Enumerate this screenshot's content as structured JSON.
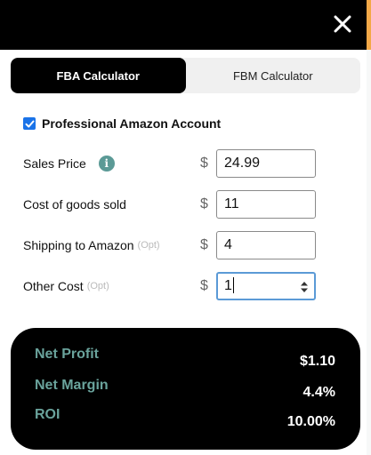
{
  "background": {
    "link_fragment": "e"
  },
  "tabs": [
    {
      "label": "FBA Calculator",
      "active": true
    },
    {
      "label": "FBM Calculator",
      "active": false
    }
  ],
  "professional_account": {
    "label": "Professional Amazon Account",
    "checked": true
  },
  "fields": {
    "sales_price": {
      "label": "Sales Price",
      "currency": "$",
      "value": "24.99"
    },
    "cogs": {
      "label": "Cost of goods sold",
      "currency": "$",
      "value": "11"
    },
    "shipping": {
      "label": "Shipping to Amazon",
      "opt": "(Opt)",
      "currency": "$",
      "value": "4"
    },
    "other_cost": {
      "label": "Other Cost",
      "opt": "(Opt)",
      "currency": "$",
      "value": "1"
    }
  },
  "results": {
    "net_profit": {
      "label": "Net Profit",
      "value": "$1.10"
    },
    "net_margin": {
      "label": "Net Margin",
      "value": "4.4%"
    },
    "roi": {
      "label": "ROI",
      "value": "10.00%"
    }
  },
  "icons": {
    "info": "info-icon",
    "close": "close-icon",
    "check": "checkmark-icon"
  },
  "colors": {
    "topbar": "#000000",
    "checkbox": "#1a73e8",
    "info_icon": "#5b9a96",
    "result_label": "#6aa39c",
    "result_panel": "#000000"
  }
}
